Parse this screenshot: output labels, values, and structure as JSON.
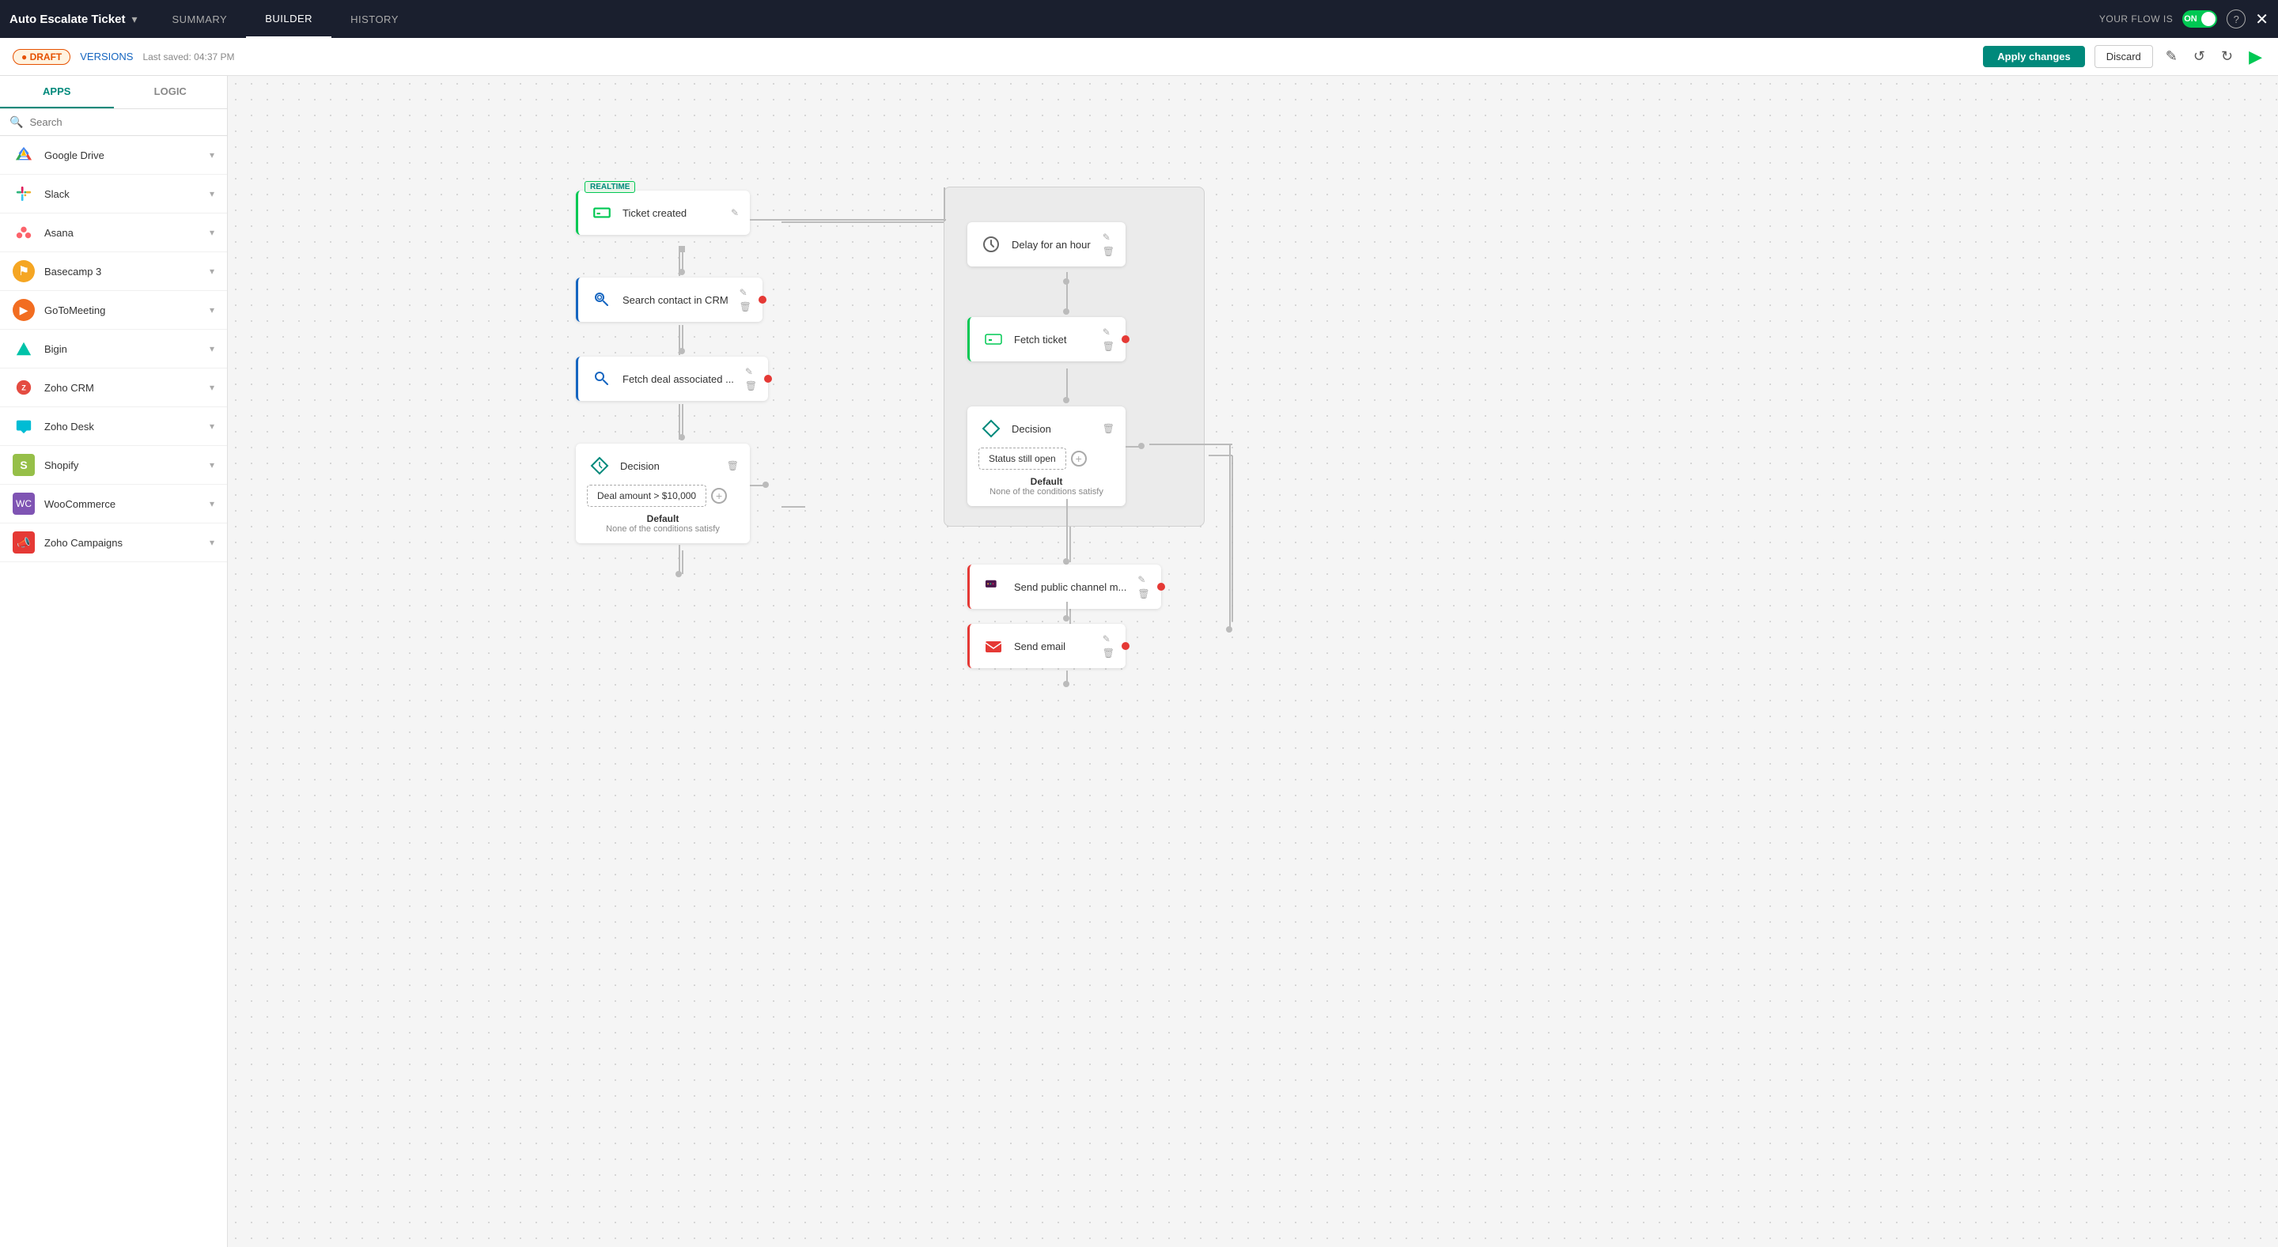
{
  "topnav": {
    "title": "Auto Escalate Ticket",
    "chevron": "▾",
    "tabs": [
      "SUMMARY",
      "BUILDER",
      "HISTORY"
    ],
    "active_tab": "BUILDER",
    "flow_label": "YOUR FLOW IS",
    "toggle_state": "ON",
    "help_label": "?",
    "close_label": "✕"
  },
  "toolbar": {
    "draft_label": "● DRAFT",
    "versions_label": "VERSIONS",
    "last_saved": "Last saved: 04:37 PM",
    "apply_label": "Apply changes",
    "discard_label": "Discard",
    "edit_icon": "✎",
    "undo_icon": "↺",
    "redo_icon": "↻",
    "run_icon": "▶"
  },
  "sidebar": {
    "tabs": [
      "APPS",
      "LOGIC"
    ],
    "active_tab": "APPS",
    "search_placeholder": "Search",
    "apps": [
      {
        "name": "Google Drive",
        "icon": "🟡",
        "color": "#4285f4"
      },
      {
        "name": "Slack",
        "icon": "💬",
        "color": "#4a154b"
      },
      {
        "name": "Asana",
        "icon": "⭕",
        "color": "#fc636b"
      },
      {
        "name": "Basecamp 3",
        "icon": "🔔",
        "color": "#f5a623"
      },
      {
        "name": "GoToMeeting",
        "icon": "🟠",
        "color": "#f26d21"
      },
      {
        "name": "Bigin",
        "icon": "🔻",
        "color": "#00c2a8"
      },
      {
        "name": "Zoho CRM",
        "icon": "🔵",
        "color": "#e44c41"
      },
      {
        "name": "Zoho Desk",
        "icon": "🟢",
        "color": "#00bcd4"
      },
      {
        "name": "Shopify",
        "icon": "🛍️",
        "color": "#96bf48"
      },
      {
        "name": "WooCommerce",
        "icon": "🛒",
        "color": "#7f54b3"
      },
      {
        "name": "Zoho Campaigns",
        "icon": "📣",
        "color": "#e53935"
      }
    ]
  },
  "canvas": {
    "nodes": {
      "ticket_created": {
        "label": "Ticket created",
        "type": "trigger",
        "badge": "REALTIME"
      },
      "search_contact": {
        "label": "Search contact in CRM",
        "type": "action_blue"
      },
      "fetch_deal": {
        "label": "Fetch deal associated ...",
        "type": "action_blue"
      },
      "decision1": {
        "label": "Decision",
        "type": "decision",
        "condition": "Deal amount > $10,000",
        "default_label": "Default",
        "default_sub": "None of the conditions satisfy"
      },
      "delay": {
        "label": "Delay for an hour",
        "type": "action"
      },
      "fetch_ticket": {
        "label": "Fetch ticket",
        "type": "action_green"
      },
      "decision2": {
        "label": "Decision",
        "type": "decision",
        "condition": "Status still open",
        "default_label": "Default",
        "default_sub": "None of the conditions satisfy"
      },
      "send_channel": {
        "label": "Send public channel m...",
        "type": "action_red_left"
      },
      "send_email": {
        "label": "Send email",
        "type": "action_red"
      }
    }
  }
}
